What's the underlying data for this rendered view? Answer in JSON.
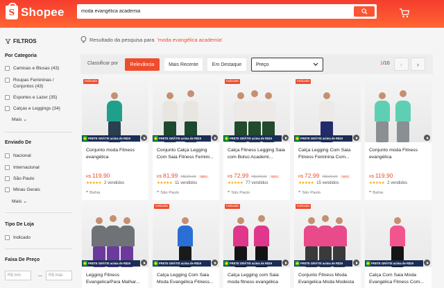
{
  "header": {
    "logo_text": "Shopee",
    "search_value": "moda evangélica academia"
  },
  "sidebar": {
    "filters_title": "FILTROS",
    "sections": [
      {
        "title": "Por Categoria",
        "items": [
          "Camisas e Blusas (43)",
          "Roupas Femininas / Conjuntos (43)",
          "Esportes e Lazer (35)",
          "Calças e Leggings (34)"
        ],
        "more": "Mais"
      },
      {
        "title": "Enviado De",
        "items": [
          "Nacional",
          "Internacional",
          "São Paulo",
          "Minas Gerais"
        ],
        "more": "Mais"
      },
      {
        "title": "Tipo De Loja",
        "items": [
          "Indicado"
        ]
      },
      {
        "title": "Faixa De Preço",
        "min_placeholder": "R$ min",
        "max_placeholder": "R$ máx"
      }
    ]
  },
  "results": {
    "prefix": "Resultado da pesquisa para",
    "query": "'moda evangélica academia'"
  },
  "sortbar": {
    "label": "Classificar por",
    "options": [
      "Relevância",
      "Mais Recente",
      "Em Destaque"
    ],
    "active_index": 0,
    "price_select": "Preço",
    "page_current": "1",
    "page_total": "/10"
  },
  "products": [
    {
      "title": "Conjunto moda Fitness evangélica",
      "currency": "R$",
      "price": "119,90",
      "old_price": "",
      "discount": "",
      "sold": "2 vendidos",
      "location": "Bahia",
      "indicado": "Indicado",
      "frete": "FRETE GRÁTIS acima de R$19",
      "colors": [
        "#2c3f4f",
        "#1fa08a"
      ]
    },
    {
      "title": "Conjunto Calça Legging Com Saia Fitness Femini...",
      "currency": "R$",
      "price": "81,99",
      "old_price": "R$200,00",
      "discount": "-59%",
      "sold": "11 vendidos",
      "location": "São Paulo",
      "indicado": "",
      "frete": "FRETE GRÁTIS acima de R$19",
      "colors": [
        "#1d4a2e",
        "#e9e6e2"
      ]
    },
    {
      "title": "Calça Fitness Legging Saia com Bolso Academi...",
      "currency": "R$",
      "price": "72,99",
      "old_price": "R$190,00",
      "discount": "-54%",
      "sold": "77 vendidos",
      "location": "São Paulo",
      "indicado": "Indicado",
      "frete": "FRETE GRÁTIS acima de R$19",
      "colors": [
        "#224a2c",
        "#ece9e6"
      ]
    },
    {
      "title": "Calça Legging Com Saia Fitness Feminina Com...",
      "currency": "R$",
      "price": "72,99",
      "old_price": "R$160,00",
      "discount": "-54%",
      "sold": "15 vendidos",
      "location": "São Paulo",
      "indicado": "Indicado",
      "frete": "FRETE GRÁTIS acima de R$19",
      "colors": [
        "#222c6a",
        "#ece9e6"
      ]
    },
    {
      "title": "Conjunto moda Fitness evangélica",
      "currency": "R$",
      "price": "119,90",
      "old_price": "",
      "discount": "",
      "sold": "2 vendidos",
      "location": "Bahia",
      "indicado": "",
      "frete": "",
      "colors": [
        "#8a8f94",
        "#5fcfb3"
      ]
    },
    {
      "title": "Legging Fitness Evangelica/Para Malhar...",
      "currency": "",
      "price": "",
      "old_price": "",
      "discount": "",
      "sold": "",
      "location": "",
      "indicado": "",
      "frete": "FRETE GRÁTIS acima de R$19",
      "colors": [
        "#6b3a9c",
        "#6f7378"
      ]
    },
    {
      "title": "Calça Legging Com Saia Moda Evangélica Fitness...",
      "currency": "",
      "price": "",
      "old_price": "",
      "discount": "",
      "sold": "",
      "location": "",
      "indicado": "Indicado",
      "frete": "FRETE GRÁTIS acima de R$19",
      "colors": [
        "#1a1a1a",
        "#2a6fd6"
      ]
    },
    {
      "title": "Calça Legging com Saia moda fitness evangélica",
      "currency": "",
      "price": "",
      "old_price": "",
      "discount": "",
      "sold": "",
      "location": "",
      "indicado": "Indicado",
      "frete": "FRETE GRÁTIS acima de R$19",
      "colors": [
        "#141414",
        "#e0368c"
      ]
    },
    {
      "title": "Conjunto Fitness Moda Evangelica Moda Modesta",
      "currency": "",
      "price": "",
      "old_price": "",
      "discount": "",
      "sold": "",
      "location": "",
      "indicado": "Indicado",
      "frete": "FRETE GRÁTIS acima de R$19",
      "colors": [
        "#3a3a3a",
        "#e94a8a"
      ]
    },
    {
      "title": "Calça Com Saia Moda Evangélica Fitness Com...",
      "currency": "",
      "price": "",
      "old_price": "",
      "discount": "",
      "sold": "",
      "location": "",
      "indicado": "",
      "frete": "FRETE GRÁTIS acima de R$19",
      "colors": [
        "#151515",
        "#f2548e"
      ]
    }
  ]
}
